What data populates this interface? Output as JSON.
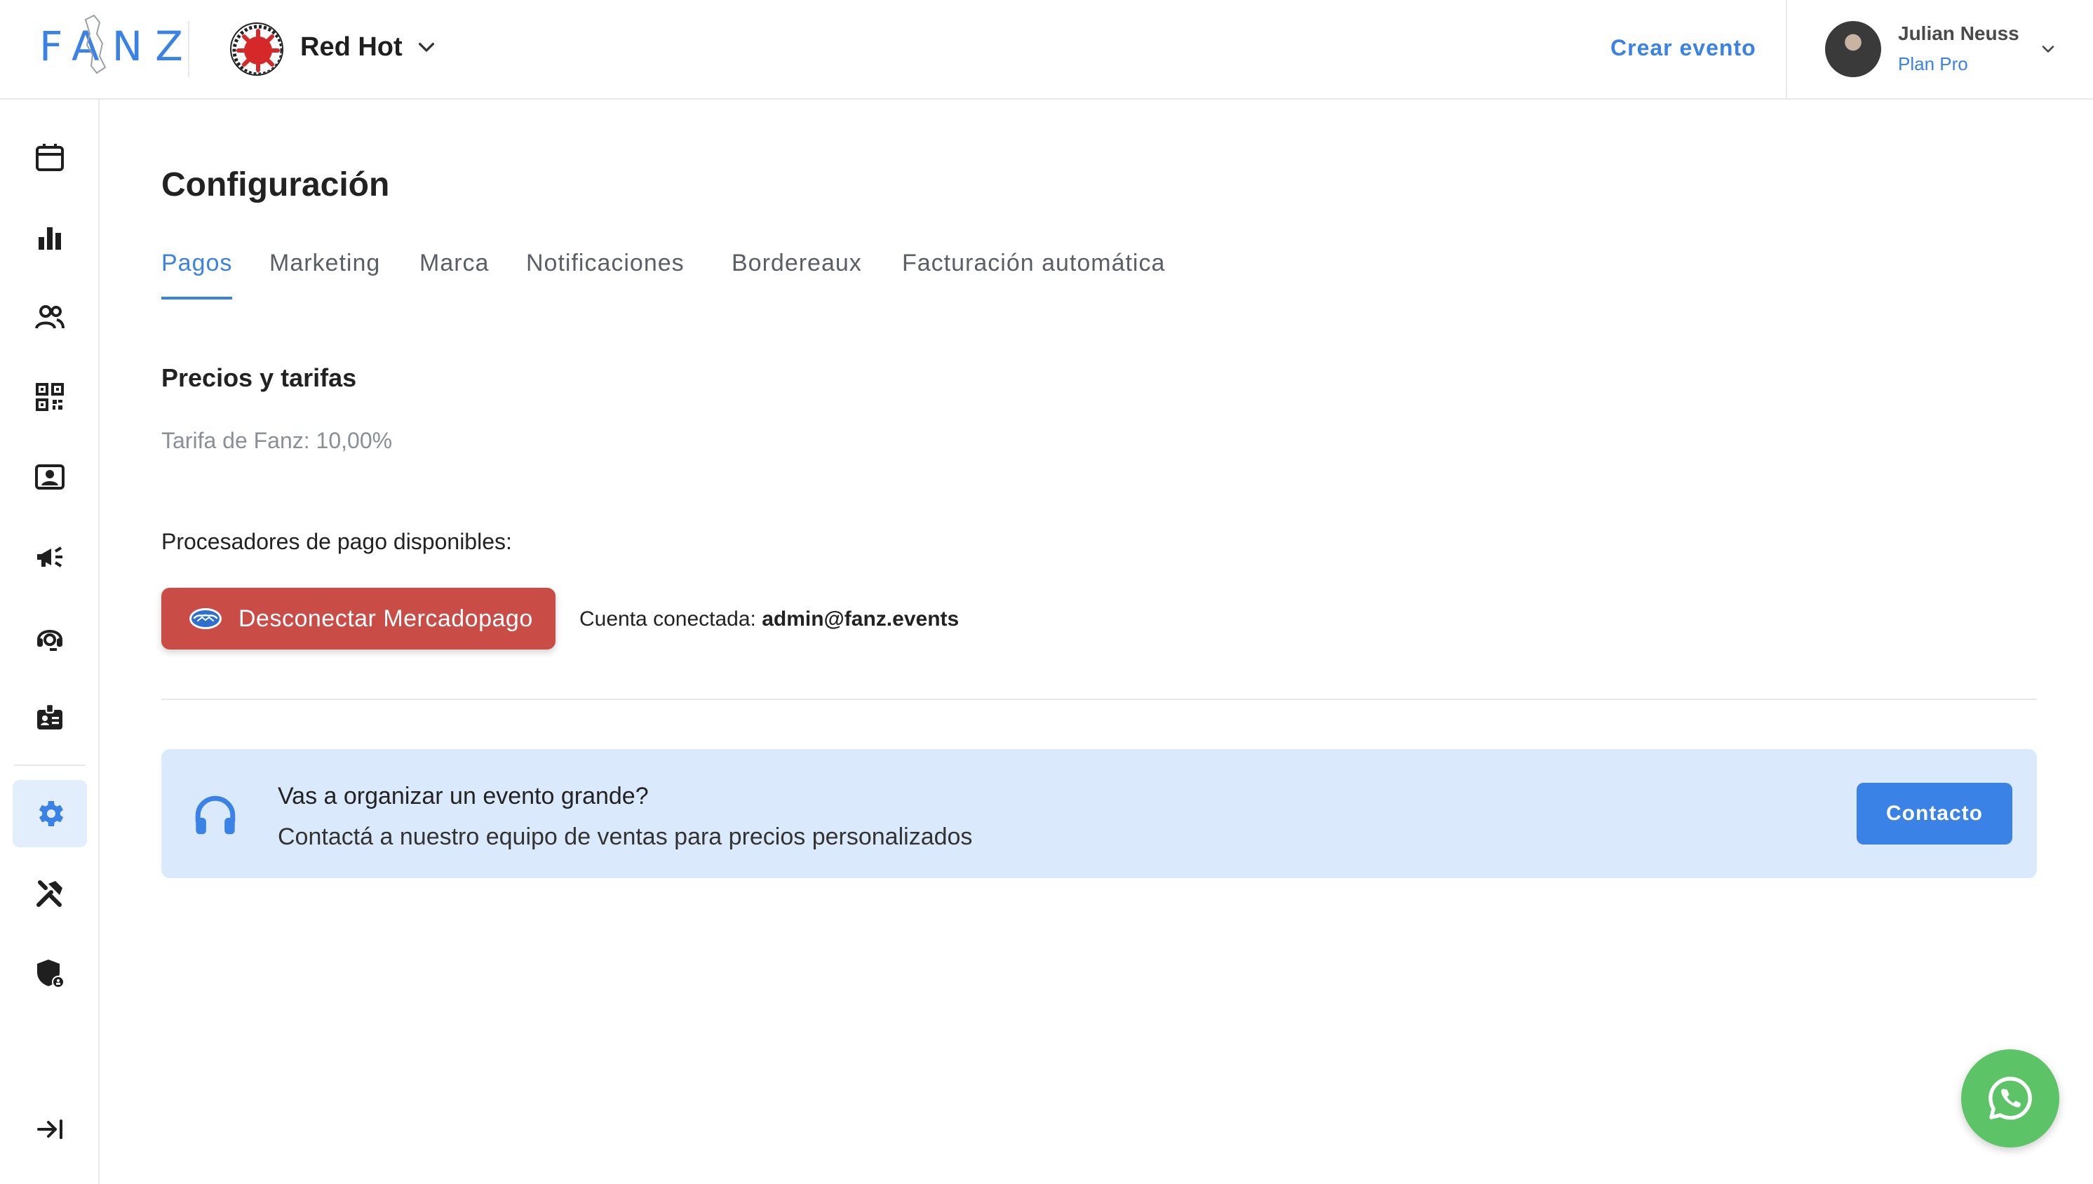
{
  "header": {
    "logo_text": "FANZ",
    "org_name": "Red Hot",
    "create_event_label": "Crear evento",
    "user": {
      "name": "Julian Neuss",
      "plan": "Plan Pro"
    }
  },
  "sidebar": {
    "items": [
      {
        "name": "calendar-icon",
        "active": false
      },
      {
        "name": "bar-chart-icon",
        "active": false
      },
      {
        "name": "people-icon",
        "active": false
      },
      {
        "name": "qr-code-icon",
        "active": false
      },
      {
        "name": "contact-card-icon",
        "active": false
      },
      {
        "name": "megaphone-icon",
        "active": false
      },
      {
        "name": "support-agent-icon",
        "active": false
      },
      {
        "name": "badge-icon",
        "active": false
      },
      {
        "name": "gear-icon",
        "active": true
      },
      {
        "name": "tools-icon",
        "active": false
      },
      {
        "name": "security-shield-icon",
        "active": false
      },
      {
        "name": "collapse-arrow-icon",
        "active": false
      }
    ]
  },
  "main": {
    "title": "Configuración",
    "tabs": [
      {
        "label": "Pagos",
        "active": true
      },
      {
        "label": "Marketing",
        "active": false
      },
      {
        "label": "Marca",
        "active": false
      },
      {
        "label": "Notificaciones",
        "active": false
      },
      {
        "label": "Bordereaux",
        "active": false
      },
      {
        "label": "Facturación automática",
        "active": false
      }
    ],
    "pricing": {
      "section_title": "Precios y tarifas",
      "fee_text": "Tarifa de Fanz: 10,00%"
    },
    "processors": {
      "label": "Procesadores de pago disponibles:",
      "disconnect_button": "Desconectar Mercadopago",
      "account_prefix": "Cuenta conectada:",
      "account_email": "admin@fanz.events"
    },
    "promo": {
      "title": "Vas a organizar un evento grande?",
      "subtitle": "Contactá a nuestro equipo de ventas para precios personalizados",
      "button": "Contacto"
    }
  },
  "colors": {
    "accent": "#3b82e6",
    "danger": "#c94c47",
    "promo_bg": "#daeafc",
    "whatsapp": "#5cc466"
  }
}
